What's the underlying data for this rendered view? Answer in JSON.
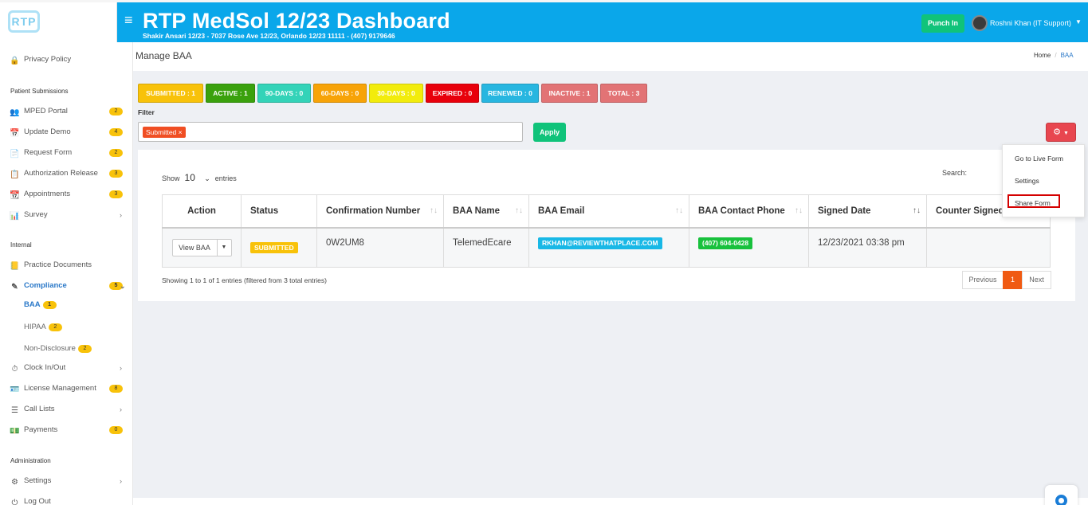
{
  "header": {
    "logo_text": "RTP",
    "title": "RTP MedSol 12/23 Dashboard",
    "subtitle": "Shakir Ansari 12/23 - 7037 Rose Ave 12/23, Orlando 12/23 11111 - (407) 9179646",
    "punch_label": "Punch In",
    "user_name": "Roshni Khan (IT Support)"
  },
  "sidebar": {
    "privacy": "Privacy Policy",
    "section_patient": "Patient Submissions",
    "mped": "MPED Portal",
    "mped_badge": "2",
    "update_demo": "Update Demo",
    "update_demo_badge": "4",
    "request_form": "Request Form",
    "request_form_badge": "2",
    "auth_release": "Authorization Release",
    "auth_release_badge": "3",
    "appointments": "Appointments",
    "appointments_badge": "3",
    "survey": "Survey",
    "section_internal": "Internal",
    "practice_docs": "Practice Documents",
    "compliance": "Compliance",
    "compliance_badge": "5",
    "baa": "BAA",
    "baa_badge": "1",
    "hipaa": "HIPAA",
    "hipaa_badge": "2",
    "non_disclosure": "Non-Disclosure",
    "non_disclosure_badge": "2",
    "clock": "Clock In/Out",
    "license": "License Management",
    "license_badge": "8",
    "call_lists": "Call Lists",
    "payments": "Payments",
    "payments_badge": "0",
    "section_admin": "Administration",
    "settings": "Settings",
    "logout": "Log Out"
  },
  "page": {
    "title": "Manage BAA",
    "breadcrumb_home": "Home",
    "breadcrumb_sep": "/",
    "breadcrumb_current": "BAA"
  },
  "stats": {
    "submitted": "SUBMITTED : 1",
    "active": "ACTIVE : 1",
    "d90": "90-DAYS : 0",
    "d60": "60-DAYS : 0",
    "d30": "30-DAYS : 0",
    "expired": "EXPIRED : 0",
    "renewed": "RENEWED : 0",
    "inactive": "INACTIVE : 1",
    "total": "TOTAL : 3",
    "colors": {
      "submitted": "#f8c20a",
      "active": "#3aa10d",
      "d90": "#33d3b8",
      "d60": "#f7a307",
      "d30": "#f2ec0c",
      "expired": "#e8000b",
      "renewed": "#27b6e0",
      "inactive": "#e27375",
      "total": "#e27375"
    }
  },
  "filter": {
    "label": "Filter",
    "tag": "Submitted ×",
    "apply": "Apply"
  },
  "dropdown": {
    "live": "Go to Live Form",
    "settings": "Settings",
    "share": "Share Form"
  },
  "table": {
    "show": "Show",
    "entries_value": "10",
    "entries": "entries",
    "search": "Search:",
    "headers": {
      "action": "Action",
      "status": "Status",
      "confirmation": "Confirmation Number",
      "baa_name": "BAA Name",
      "baa_email": "BAA Email",
      "phone": "BAA Contact Phone",
      "signed": "Signed Date",
      "counter": "Counter Signed"
    },
    "row": {
      "view": "View BAA",
      "status": "SUBMITTED",
      "confirmation": "0W2UM8",
      "name": "TelemedEcare",
      "email": "RKHAN@REVIEWTHATPLACE.COM",
      "phone": "(407) 604-0428",
      "signed": "12/23/2021 03:38 pm",
      "counter": ""
    },
    "showing": "Showing 1 to 1 of 1 entries (filtered from 3 total entries)",
    "prev": "Previous",
    "page": "1",
    "next": "Next"
  }
}
